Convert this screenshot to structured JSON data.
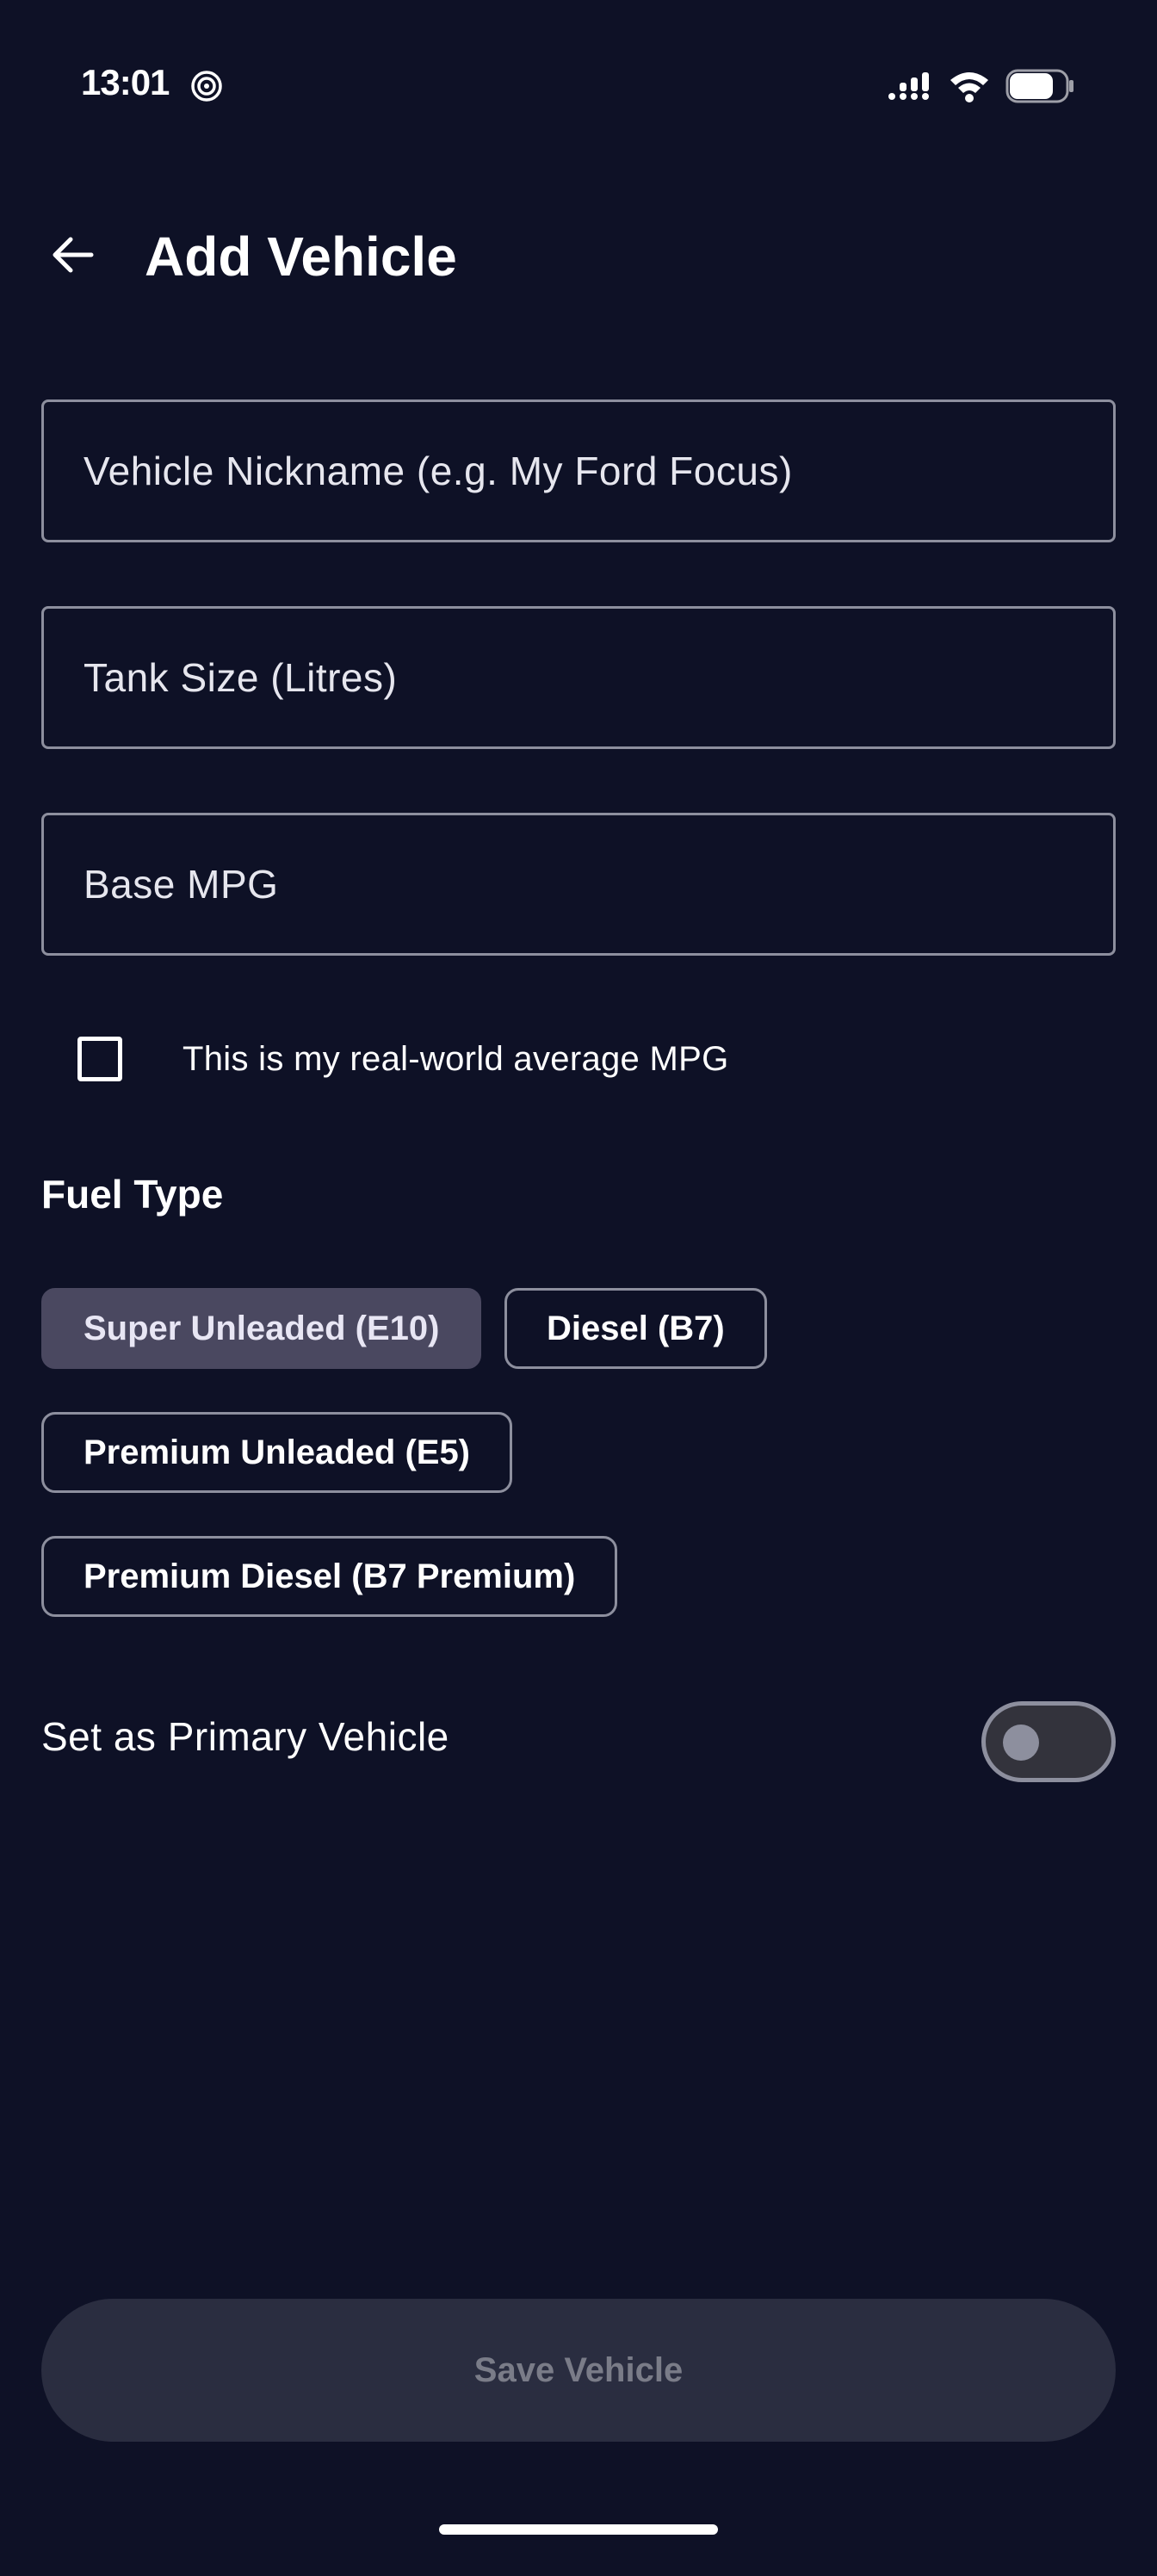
{
  "status_bar": {
    "time": "13:01",
    "icons": [
      "spiral-icon",
      "signal-icon",
      "wifi-icon",
      "battery-icon"
    ]
  },
  "app_bar": {
    "back_icon": "arrow-left-icon",
    "title": "Add Vehicle"
  },
  "form": {
    "nickname_placeholder": "Vehicle Nickname (e.g. My Ford Focus)",
    "nickname_value": "",
    "tank_size_placeholder": "Tank Size (Litres)",
    "tank_size_value": "",
    "base_mpg_placeholder": "Base MPG",
    "base_mpg_value": "",
    "real_world_checkbox_label": "This is my real-world average MPG",
    "real_world_checked": false
  },
  "fuel_type": {
    "label": "Fuel Type",
    "options": [
      {
        "label": "Super Unleaded (E10)",
        "selected": true
      },
      {
        "label": "Diesel (B7)",
        "selected": false
      },
      {
        "label": "Premium Unleaded (E5)",
        "selected": false
      },
      {
        "label": "Premium Diesel (B7 Premium)",
        "selected": false
      }
    ]
  },
  "primary_vehicle": {
    "label": "Set as Primary Vehicle",
    "enabled": false
  },
  "actions": {
    "save_label": "Save Vehicle"
  },
  "colors": {
    "background": "#0e1126",
    "border": "#8d8f9e",
    "chip_selected": "#4a4860",
    "button_disabled": "#2a2d40"
  }
}
